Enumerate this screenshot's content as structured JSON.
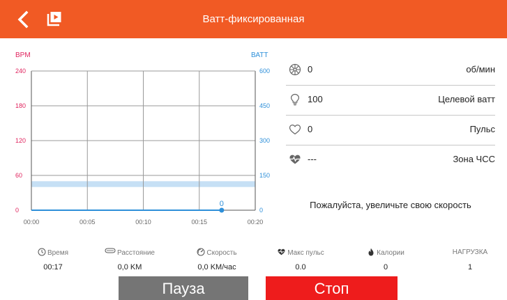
{
  "header": {
    "title": "Ватт-фиксированная"
  },
  "chart_data": {
    "type": "line",
    "title": "",
    "left_axis": {
      "label": "BPM",
      "ticks": [
        0,
        60,
        120,
        180,
        240
      ],
      "range": [
        0,
        240
      ],
      "color": "#e0245e"
    },
    "right_axis": {
      "label": "ВАТТ",
      "ticks": [
        0,
        150,
        300,
        450,
        600
      ],
      "range": [
        0,
        600
      ],
      "color": "#2d8fd9"
    },
    "x_axis": {
      "ticks": [
        "00:00",
        "00:05",
        "00:10",
        "00:15",
        "00:20"
      ],
      "range_minutes": [
        0,
        20
      ]
    },
    "target_band": {
      "axis": "BPM",
      "from": 40,
      "to": 50,
      "color": "#c6e0f5"
    },
    "series": [
      {
        "axis": "ВАТТ",
        "color": "#2d8fd9",
        "points": [
          [
            0,
            0
          ],
          [
            17,
            0
          ]
        ],
        "last_value_label": "0"
      }
    ],
    "grid": true
  },
  "stats": [
    {
      "icon": "wheel-icon",
      "value": "0",
      "unit": "об/мин"
    },
    {
      "icon": "lightbulb-icon",
      "value": "100",
      "unit": "Целевой ватт"
    },
    {
      "icon": "heart-outline-icon",
      "value": "0",
      "unit": "Пульс"
    },
    {
      "icon": "heart-pulse-icon",
      "value": "---",
      "unit": "Зона ЧСС"
    }
  ],
  "hint": "Пожалуйста, увеличьте свою скорость",
  "metrics": [
    {
      "icon": "clock-icon",
      "label": "Время",
      "value": "00:17"
    },
    {
      "icon": "track-icon",
      "label": "Расстояние",
      "value": "0,0 KM"
    },
    {
      "icon": "gauge-icon",
      "label": "Скорость",
      "value": "0,0 KM/час"
    },
    {
      "icon": "heart-filled-icon",
      "label": "Макс пульс",
      "value": "0.0"
    },
    {
      "icon": "flame-icon",
      "label": "Калории",
      "value": "0"
    },
    {
      "icon": "",
      "label": "НАГРУЗКА",
      "value": "1"
    }
  ],
  "buttons": {
    "pause": "Пауза",
    "stop": "Стоп"
  },
  "colors": {
    "accent": "#f15a24",
    "pause": "#757575",
    "stop": "#ee1c1c"
  }
}
